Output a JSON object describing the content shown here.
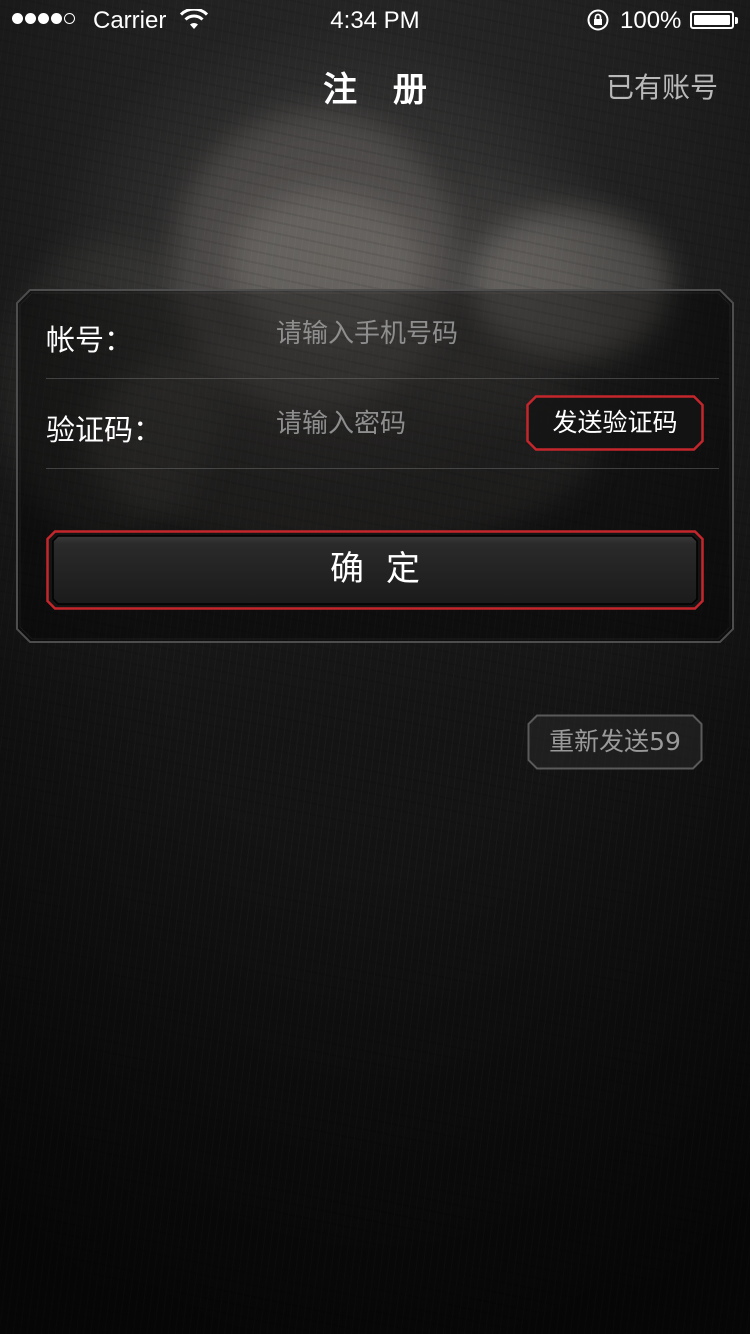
{
  "status_bar": {
    "carrier": "Carrier",
    "time": "4:34 PM",
    "battery_percent": "100%",
    "signal_bars_filled": 4,
    "signal_bars_total": 5
  },
  "nav": {
    "title": "注 册",
    "right_link": "已有账号"
  },
  "form": {
    "account": {
      "label": "帐号：",
      "placeholder": "请输入手机号码",
      "value": ""
    },
    "code": {
      "label": "验证码：",
      "placeholder": "请输入密码",
      "value": ""
    },
    "send_code_label": "发送验证码",
    "confirm_label": "确定"
  },
  "resend": {
    "label": "重新发送59"
  },
  "colors": {
    "accent_red": "#c4262c",
    "panel_border": "#4a4a4a",
    "muted_text": "#9a9a9a"
  }
}
